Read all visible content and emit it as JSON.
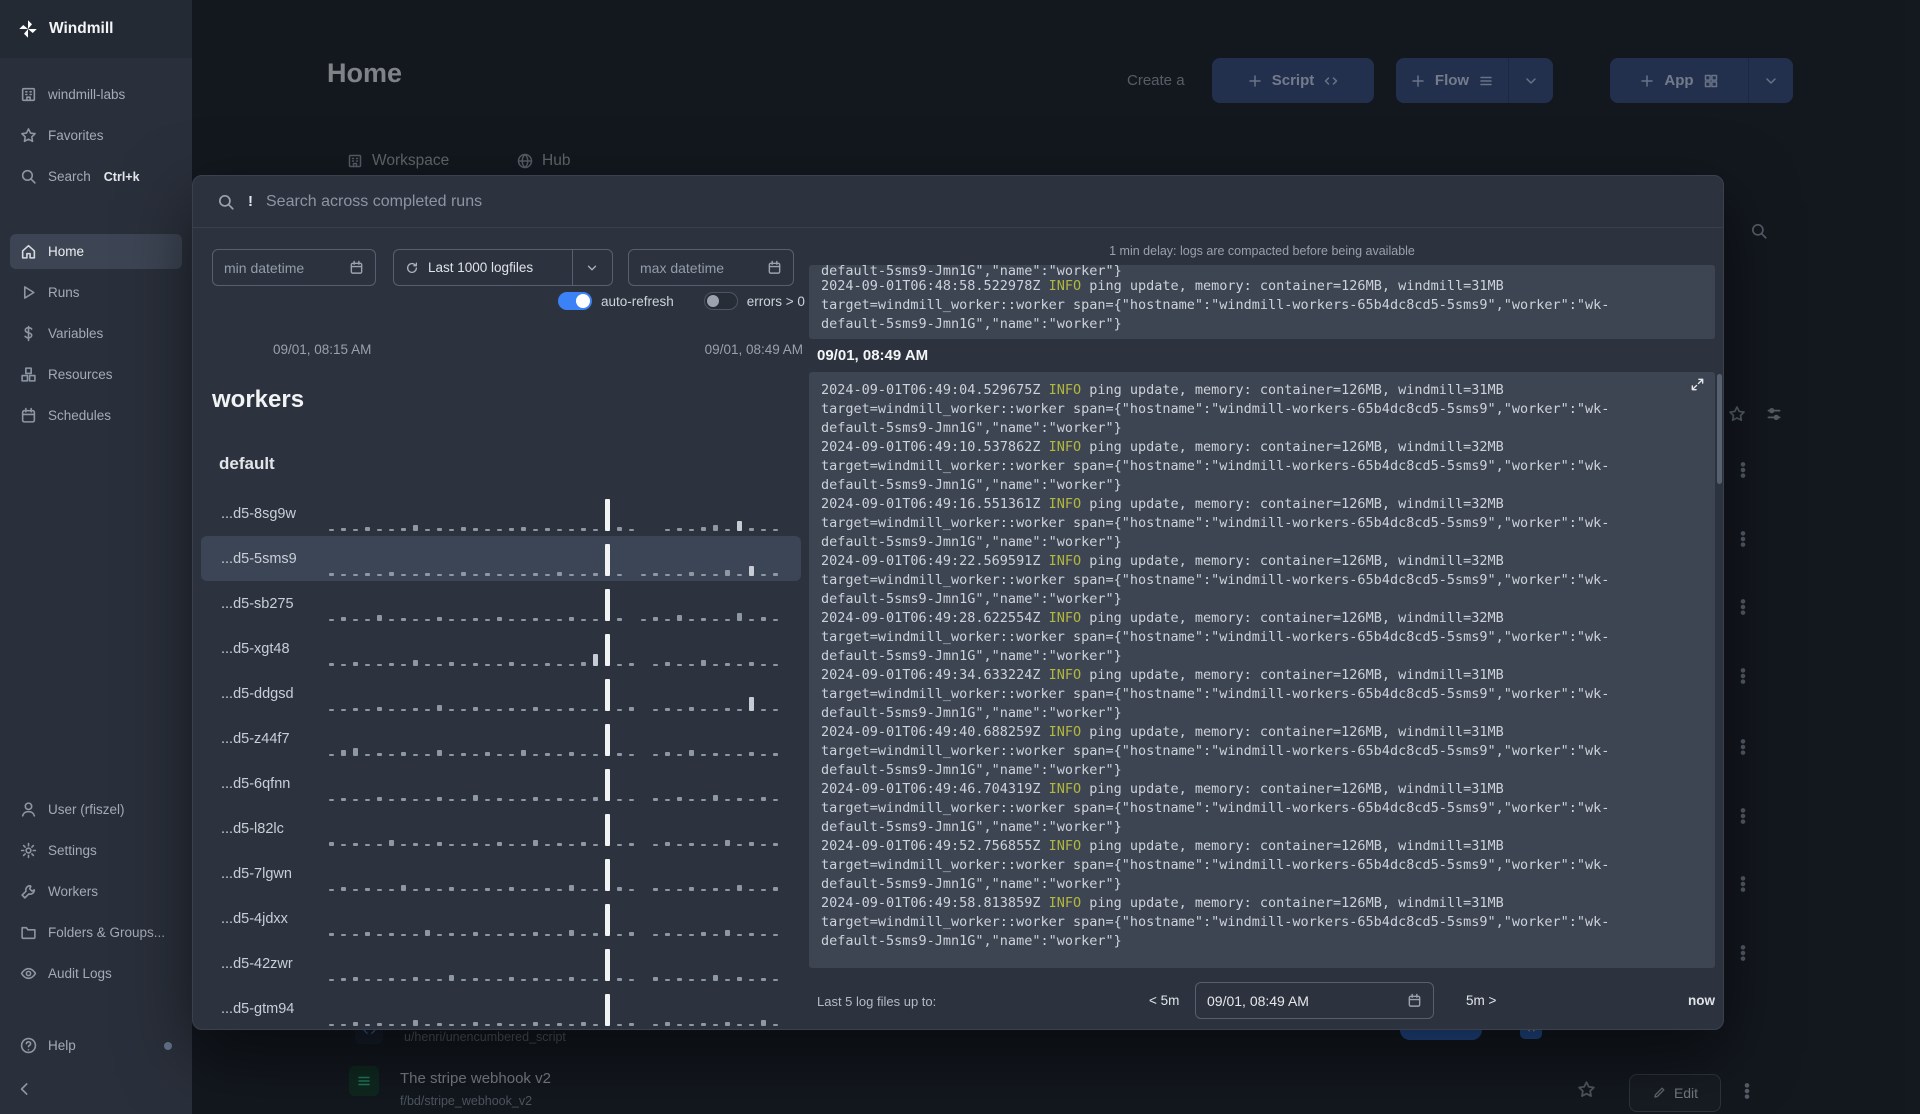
{
  "app": {
    "name": "Windmill"
  },
  "colors": {
    "toggle_on": "#3b82f6",
    "log_info": "#b2b83d",
    "badge_blue": "#3b82f6"
  },
  "sidebar": {
    "top_items": [
      {
        "label": "windmill-labs",
        "icon": "building-icon"
      },
      {
        "label": "Favorites",
        "icon": "star-icon"
      },
      {
        "label": "Search",
        "icon": "search-icon",
        "shortcut": "Ctrl+k"
      }
    ],
    "nav_items": [
      {
        "label": "Home",
        "icon": "home-icon",
        "active": true
      },
      {
        "label": "Runs",
        "icon": "play-icon"
      },
      {
        "label": "Variables",
        "icon": "dollar-icon"
      },
      {
        "label": "Resources",
        "icon": "boxes-icon"
      },
      {
        "label": "Schedules",
        "icon": "calendar-icon"
      }
    ],
    "bottom_items": [
      {
        "label": "User (rfiszel)",
        "icon": "user-icon"
      },
      {
        "label": "Settings",
        "icon": "gear-icon"
      },
      {
        "label": "Workers",
        "icon": "wrench-icon"
      },
      {
        "label": "Folders & Groups...",
        "icon": "folder-icon"
      },
      {
        "label": "Audit Logs",
        "icon": "eye-icon"
      }
    ],
    "help_label": "Help"
  },
  "header": {
    "title": "Home",
    "create_label": "Create a",
    "script_button": "Script",
    "flow_button": "Flow",
    "app_button": "App"
  },
  "tabs": {
    "workspace": "Workspace",
    "hub": "Hub"
  },
  "modal": {
    "search_prefix": "!",
    "search_placeholder": "Search across completed runs",
    "min_datetime_placeholder": "min datetime",
    "logfiles_select_value": "Last 1000 logfiles",
    "max_datetime_placeholder": "max datetime",
    "auto_refresh_label": "auto-refresh",
    "errors_label": "errors > 0",
    "range_start": "09/01, 08:15 AM",
    "range_end": "09/01, 08:49 AM",
    "workers_title": "workers",
    "worker_group": "default",
    "workers": [
      {
        "name": "...d5-8sg9w",
        "bars": [
          2,
          3,
          2,
          4,
          2,
          2,
          3,
          6,
          2,
          3,
          2,
          4,
          3,
          2,
          2,
          3,
          4,
          2,
          3,
          2,
          2,
          3,
          2,
          32,
          4,
          2,
          0,
          0,
          2,
          3,
          2,
          4,
          6,
          2,
          10,
          3,
          2,
          2
        ]
      },
      {
        "name": "...d5-5sms9",
        "selected": true,
        "bars": [
          3,
          2,
          2,
          3,
          2,
          4,
          2,
          2,
          3,
          2,
          2,
          4,
          2,
          3,
          2,
          2,
          2,
          3,
          2,
          4,
          2,
          2,
          3,
          32,
          2,
          0,
          2,
          3,
          2,
          2,
          4,
          2,
          2,
          6,
          2,
          10,
          2,
          3
        ]
      },
      {
        "name": "...d5-sb275",
        "bars": [
          2,
          4,
          2,
          2,
          6,
          2,
          3,
          2,
          2,
          4,
          2,
          2,
          3,
          2,
          4,
          2,
          2,
          3,
          2,
          2,
          4,
          2,
          2,
          32,
          3,
          0,
          2,
          4,
          2,
          6,
          2,
          3,
          2,
          2,
          8,
          2,
          4,
          2
        ]
      },
      {
        "name": "...d5-xgt48",
        "bars": [
          3,
          2,
          4,
          2,
          2,
          3,
          2,
          6,
          2,
          2,
          4,
          2,
          3,
          2,
          2,
          4,
          2,
          2,
          3,
          2,
          2,
          4,
          12,
          32,
          2,
          3,
          0,
          2,
          4,
          2,
          2,
          6,
          2,
          3,
          2,
          4,
          2,
          2
        ]
      },
      {
        "name": "...d5-ddgsd",
        "bars": [
          2,
          2,
          3,
          2,
          4,
          2,
          2,
          3,
          2,
          6,
          2,
          2,
          4,
          2,
          2,
          3,
          2,
          4,
          2,
          2,
          3,
          2,
          2,
          32,
          2,
          4,
          0,
          2,
          3,
          2,
          4,
          2,
          2,
          3,
          2,
          14,
          2,
          2
        ]
      },
      {
        "name": "...d5-z44f7",
        "bars": [
          2,
          6,
          8,
          2,
          3,
          2,
          4,
          2,
          2,
          6,
          2,
          3,
          2,
          4,
          2,
          2,
          6,
          2,
          3,
          2,
          4,
          2,
          2,
          32,
          3,
          2,
          0,
          2,
          4,
          2,
          6,
          2,
          3,
          2,
          2,
          4,
          2,
          3
        ]
      },
      {
        "name": "...d5-6qfnn",
        "bars": [
          2,
          3,
          2,
          2,
          4,
          2,
          3,
          2,
          2,
          4,
          2,
          2,
          6,
          2,
          3,
          2,
          2,
          4,
          2,
          3,
          2,
          2,
          4,
          32,
          2,
          2,
          0,
          3,
          2,
          4,
          2,
          2,
          6,
          2,
          3,
          2,
          4,
          2
        ]
      },
      {
        "name": "...d5-l82lc",
        "bars": [
          4,
          2,
          3,
          2,
          2,
          6,
          2,
          3,
          2,
          4,
          2,
          2,
          3,
          2,
          4,
          2,
          2,
          6,
          2,
          3,
          2,
          4,
          2,
          32,
          2,
          3,
          0,
          2,
          4,
          2,
          3,
          2,
          2,
          6,
          2,
          4,
          2,
          3
        ]
      },
      {
        "name": "...d5-7lgwn",
        "bars": [
          2,
          4,
          2,
          3,
          2,
          2,
          6,
          2,
          3,
          2,
          4,
          2,
          2,
          3,
          2,
          4,
          2,
          2,
          3,
          2,
          6,
          2,
          2,
          32,
          4,
          2,
          0,
          3,
          2,
          2,
          4,
          2,
          3,
          2,
          6,
          2,
          2,
          4
        ]
      },
      {
        "name": "...d5-4jdxx",
        "bars": [
          3,
          2,
          2,
          4,
          2,
          3,
          2,
          2,
          6,
          2,
          3,
          2,
          4,
          2,
          2,
          3,
          2,
          4,
          2,
          2,
          6,
          2,
          3,
          32,
          2,
          4,
          0,
          2,
          3,
          2,
          2,
          4,
          2,
          6,
          2,
          3,
          2,
          2
        ]
      },
      {
        "name": "...d5-42zwr",
        "bars": [
          2,
          3,
          4,
          2,
          2,
          3,
          2,
          4,
          2,
          2,
          6,
          2,
          3,
          2,
          2,
          4,
          2,
          3,
          2,
          2,
          4,
          2,
          2,
          32,
          3,
          2,
          0,
          4,
          2,
          3,
          2,
          2,
          6,
          2,
          4,
          2,
          3,
          2
        ]
      },
      {
        "name": "...d5-gtm94",
        "bars": [
          2,
          2,
          4,
          2,
          3,
          2,
          2,
          6,
          2,
          3,
          2,
          2,
          4,
          2,
          3,
          2,
          2,
          4,
          2,
          3,
          2,
          4,
          2,
          32,
          2,
          3,
          0,
          2,
          4,
          2,
          2,
          3,
          2,
          4,
          2,
          2,
          6,
          2
        ]
      }
    ],
    "delay_notice": "1 min delay: logs are compacted before being available",
    "log": {
      "clipped_line": "default-5sms9-Jmn1G\",\"name\":\"worker\"}",
      "previous_entries": [
        {
          "ts": "2024-09-01T06:48:58.522978Z",
          "level": "INFO",
          "msg": "ping update, memory: container=126MB, windmill=31MB"
        }
      ],
      "section_header": "09/01, 08:49 AM",
      "target_lines": [
        "target=windmill_worker::worker span={\"hostname\":\"windmill-workers-65b4dc8cd5-5sms9\",\"worker\":\"wk-",
        "default-5sms9-Jmn1G\",\"name\":\"worker\"}"
      ],
      "entries": [
        {
          "ts": "2024-09-01T06:49:04.529675Z",
          "level": "INFO",
          "msg": "ping update, memory: container=126MB, windmill=31MB"
        },
        {
          "ts": "2024-09-01T06:49:10.537862Z",
          "level": "INFO",
          "msg": "ping update, memory: container=126MB, windmill=32MB"
        },
        {
          "ts": "2024-09-01T06:49:16.551361Z",
          "level": "INFO",
          "msg": "ping update, memory: container=126MB, windmill=32MB"
        },
        {
          "ts": "2024-09-01T06:49:22.569591Z",
          "level": "INFO",
          "msg": "ping update, memory: container=126MB, windmill=32MB"
        },
        {
          "ts": "2024-09-01T06:49:28.622554Z",
          "level": "INFO",
          "msg": "ping update, memory: container=126MB, windmill=32MB"
        },
        {
          "ts": "2024-09-01T06:49:34.633224Z",
          "level": "INFO",
          "msg": "ping update, memory: container=126MB, windmill=31MB"
        },
        {
          "ts": "2024-09-01T06:49:40.688259Z",
          "level": "INFO",
          "msg": "ping update, memory: container=126MB, windmill=31MB"
        },
        {
          "ts": "2024-09-01T06:49:46.704319Z",
          "level": "INFO",
          "msg": "ping update, memory: container=126MB, windmill=31MB"
        },
        {
          "ts": "2024-09-01T06:49:52.756855Z",
          "level": "INFO",
          "msg": "ping update, memory: container=126MB, windmill=31MB"
        },
        {
          "ts": "2024-09-01T06:49:58.813859Z",
          "level": "INFO",
          "msg": "ping update, memory: container=126MB, windmill=31MB"
        }
      ]
    },
    "footer": {
      "label": "Last 5 log files up to:",
      "back": "< 5m",
      "datetime": "09/01, 08:49 AM",
      "forward": "5m >",
      "now": "now"
    }
  },
  "background": {
    "row_partial": {
      "path": "u/henri/unencumbered_script"
    },
    "row_script": {
      "title": "The stripe webhook v2",
      "path": "f/bd/stripe_webhook_v2",
      "edit_label": "Edit"
    }
  }
}
